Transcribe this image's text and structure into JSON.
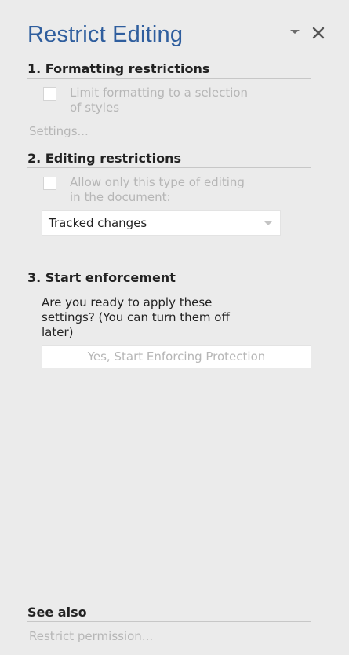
{
  "pane": {
    "title": "Restrict Editing",
    "menu_icon": "chevron-down-icon",
    "close_icon": "close-icon"
  },
  "formatting": {
    "heading": "1. Formatting restrictions",
    "checkbox_label_line1": "Limit formatting to a selection",
    "checkbox_label_line2": "of styles",
    "checkbox_checked": false,
    "settings_link": "Settings..."
  },
  "editing": {
    "heading": "2. Editing restrictions",
    "checkbox_label_line1": "Allow only this type of editing",
    "checkbox_label_line2": "in the document:",
    "checkbox_checked": false,
    "dropdown_value": "Tracked changes"
  },
  "enforcement": {
    "heading": "3. Start enforcement",
    "prompt_line1": "Are you ready to apply these",
    "prompt_line2": "settings? (You can turn them off",
    "prompt_line3": "later)",
    "button_label": "Yes, Start Enforcing Protection"
  },
  "see_also": {
    "heading": "See also",
    "link": "Restrict permission..."
  },
  "colors": {
    "title": "#2f5e9e",
    "background": "#ebebeb",
    "disabled_text": "#b6b6b6"
  }
}
